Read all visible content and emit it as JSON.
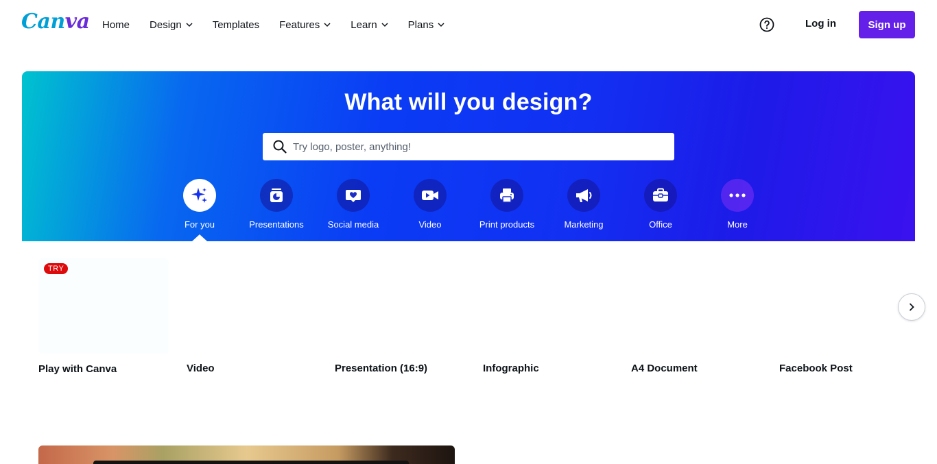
{
  "header": {
    "logo_text_part1": "Can",
    "logo_text_part2": "va",
    "nav": [
      {
        "label": "Home",
        "has_dropdown": false
      },
      {
        "label": "Design",
        "has_dropdown": true
      },
      {
        "label": "Templates",
        "has_dropdown": false
      },
      {
        "label": "Features",
        "has_dropdown": true
      },
      {
        "label": "Learn",
        "has_dropdown": true
      },
      {
        "label": "Plans",
        "has_dropdown": true
      }
    ],
    "help_icon": "question-circle-icon",
    "login_label": "Log in",
    "signup_label": "Sign up"
  },
  "hero": {
    "title": "What will you design?",
    "search_placeholder": "Try logo, poster, anything!",
    "categories": [
      {
        "label": "For you",
        "icon": "sparkle-icon",
        "active": true
      },
      {
        "label": "Presentations",
        "icon": "presentation-chart-icon",
        "active": false
      },
      {
        "label": "Social media",
        "icon": "heart-chat-icon",
        "active": false
      },
      {
        "label": "Video",
        "icon": "video-camera-icon",
        "active": false
      },
      {
        "label": "Print products",
        "icon": "printer-icon",
        "active": false
      },
      {
        "label": "Marketing",
        "icon": "megaphone-icon",
        "active": false
      },
      {
        "label": "Office",
        "icon": "briefcase-icon",
        "active": false
      },
      {
        "label": "More",
        "icon": "more-dots-icon",
        "active": false
      }
    ]
  },
  "design_types": [
    {
      "label": "Play with Canva",
      "badge": "TRY"
    },
    {
      "label": "Video"
    },
    {
      "label": "Presentation (16:9)"
    },
    {
      "label": "Infographic"
    },
    {
      "label": "A4 Document"
    },
    {
      "label": "Facebook Post"
    }
  ],
  "colors": {
    "brand_purple": "#6420e8",
    "logo_cyan": "#00a0d6",
    "badge_red": "#dd0b0b"
  }
}
